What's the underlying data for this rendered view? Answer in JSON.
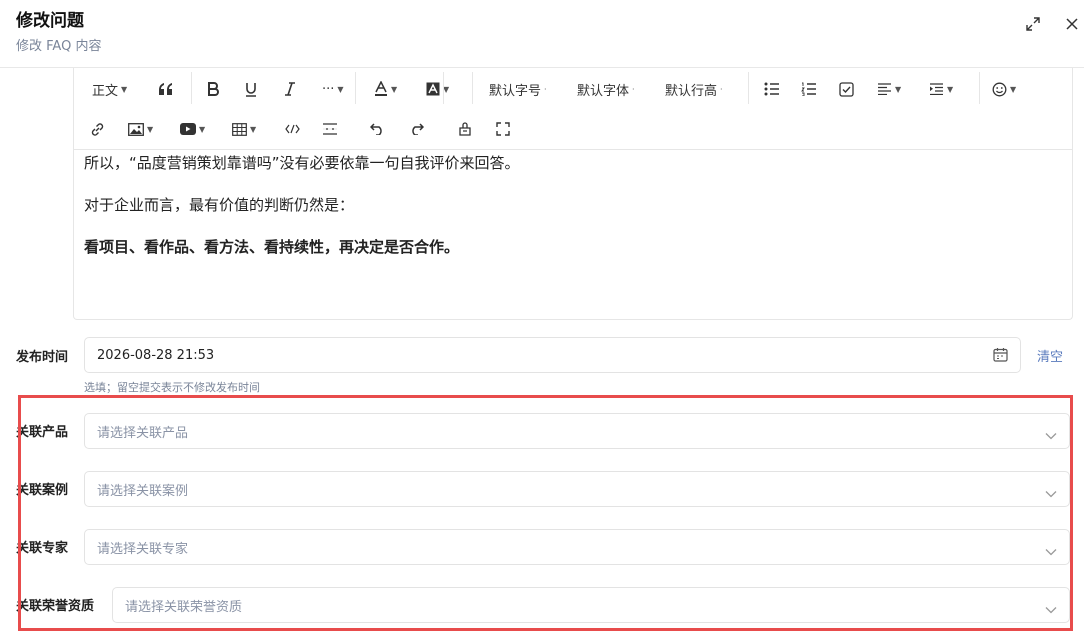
{
  "header": {
    "title": "修改问题",
    "subtitle": "修改 FAQ 内容"
  },
  "toolbar": {
    "paragraph": "正文",
    "font_size": "默认字号",
    "font_family": "默认字体",
    "line_height": "默认行高",
    "more": "···"
  },
  "content": {
    "paragraphs": [
      "所以，“品度营销策划靠谱吗”没有必要依靠一句自我评价来回答。",
      "对于企业而言，最有价值的判断仍然是：",
      "看项目、看作品、看方法、看持续性，再决定是否合作。"
    ]
  },
  "publish": {
    "label": "发布时间",
    "value": "2026-08-28 21:53",
    "clear": "清空",
    "hint": "选填；留空提交表示不修改发布时间"
  },
  "relations": [
    {
      "label": "关联产品",
      "placeholder": "请选择关联产品"
    },
    {
      "label": "关联案例",
      "placeholder": "请选择关联案例"
    },
    {
      "label": "关联专家",
      "placeholder": "请选择关联专家"
    },
    {
      "label": "关联荣誉资质",
      "placeholder": "请选择关联荣誉资质"
    }
  ],
  "colors": {
    "highlight": "#e84c4c",
    "link": "#5a7bbd",
    "muted": "#7a8599"
  }
}
